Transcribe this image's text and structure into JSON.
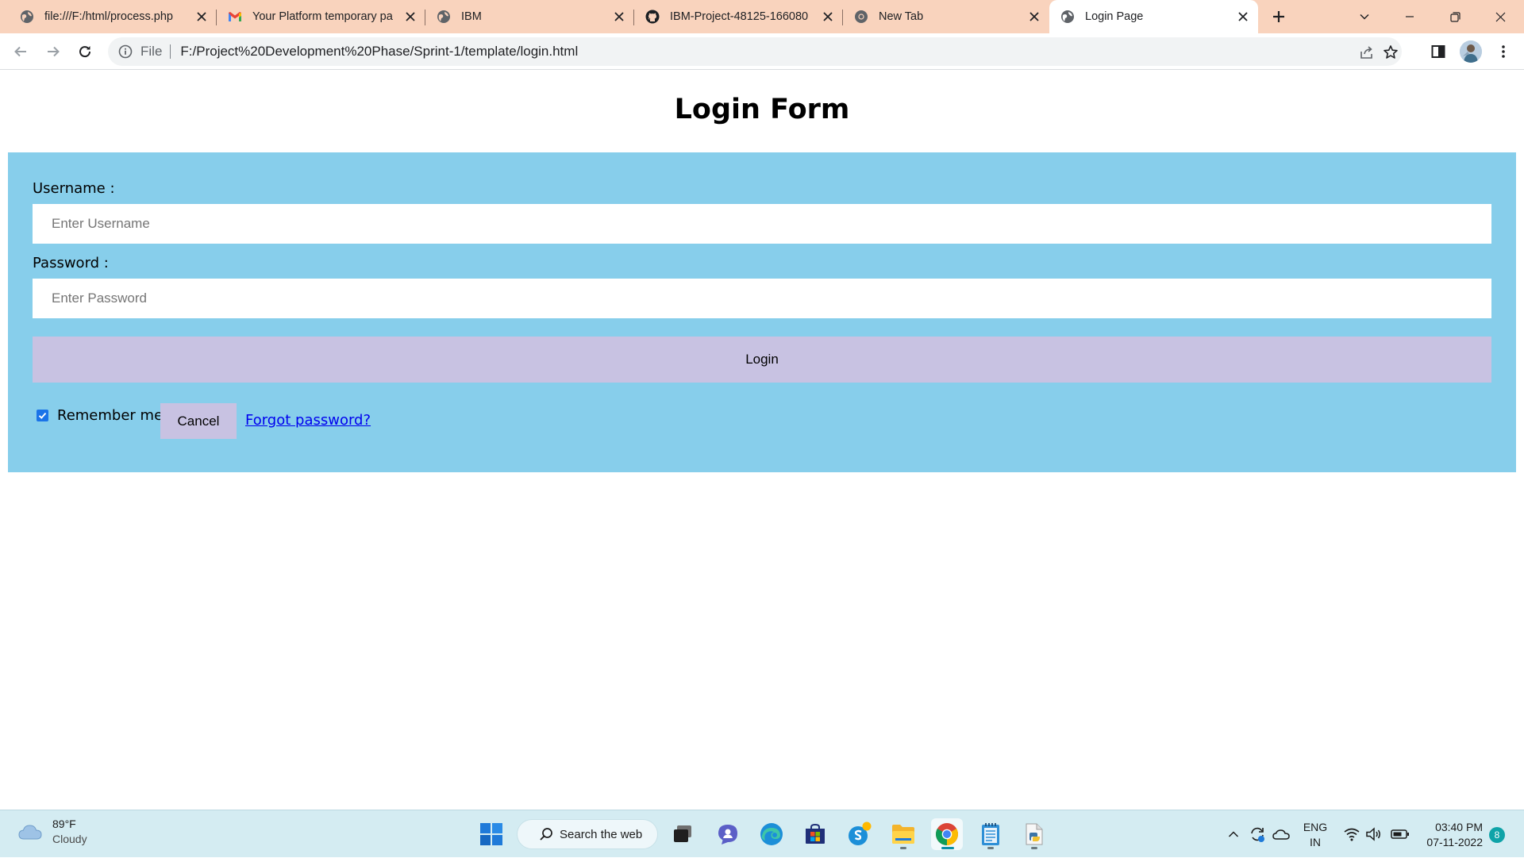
{
  "browser": {
    "tabs": [
      {
        "title": "file:///F:/html/process.php",
        "icon": "globe-icon"
      },
      {
        "title": "Your Platform temporary pa",
        "icon": "gmail-icon"
      },
      {
        "title": "IBM",
        "icon": "globe-icon"
      },
      {
        "title": "IBM-Project-48125-166080",
        "icon": "github-icon"
      },
      {
        "title": "New Tab",
        "icon": "chrome-icon"
      },
      {
        "title": "Login Page",
        "icon": "globe-icon",
        "active": true
      }
    ],
    "address": {
      "scheme": "File",
      "url": "F:/Project%20Development%20Phase/Sprint-1/template/login.html"
    }
  },
  "page": {
    "title": "Login Form",
    "form": {
      "username_label": "Username :",
      "username_placeholder": "Enter Username",
      "password_label": "Password :",
      "password_placeholder": "Enter Password",
      "login_label": "Login",
      "remember_label": "Remember me",
      "remember_checked": true,
      "cancel_label": "Cancel",
      "forgot_label": "Forgot password?"
    },
    "colors": {
      "form_background": "#87ceeb",
      "button_background": "#c8c2e2",
      "link": "#0000ee"
    }
  },
  "taskbar": {
    "weather": {
      "temp": "89°F",
      "condition": "Cloudy"
    },
    "search_label": "Search the web",
    "language": {
      "line1": "ENG",
      "line2": "IN"
    },
    "clock": {
      "time": "03:40 PM",
      "date": "07-11-2022"
    },
    "notification_count": "8",
    "pinned_apps": [
      "windows-start-icon",
      "task-view-icon",
      "teams-chat-icon",
      "edge-icon",
      "store-icon",
      "skype-icon",
      "file-explorer-icon",
      "chrome-icon",
      "notepad-icon",
      "python-icon"
    ]
  }
}
